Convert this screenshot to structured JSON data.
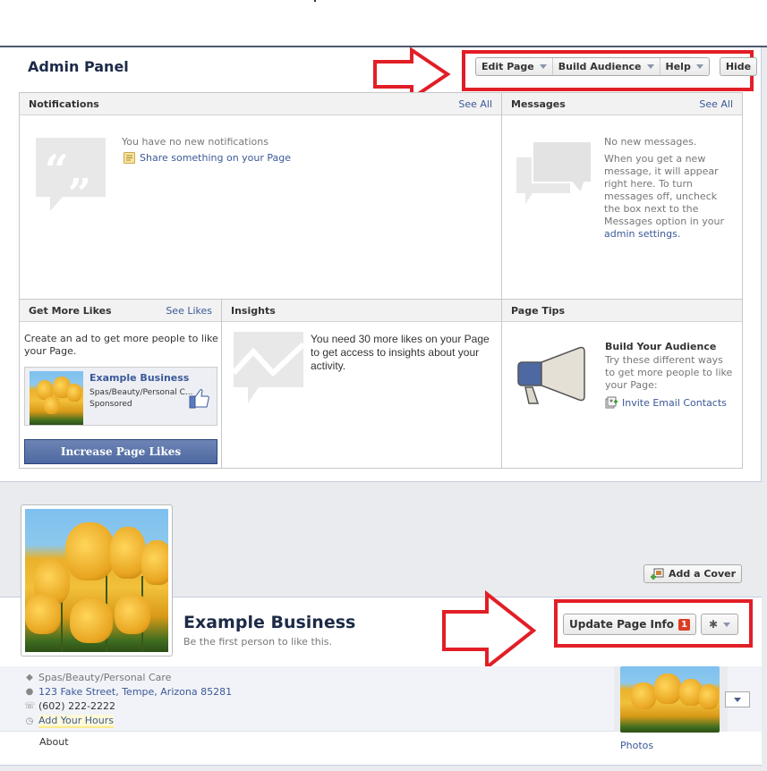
{
  "admin_panel": {
    "title": "Admin Panel",
    "toolbar": {
      "edit_page": "Edit Page",
      "build_audience": "Build Audience",
      "help": "Help",
      "hide": "Hide"
    },
    "notifications": {
      "title": "Notifications",
      "see_all": "See All",
      "empty_text": "You have no new notifications",
      "share_link": "Share something on your Page"
    },
    "messages": {
      "title": "Messages",
      "see_all": "See All",
      "empty_text": "No new messages.",
      "body": "When you get a new message, it will appear right here. To turn messages off, uncheck the box next to the Messages option in your",
      "settings_link": "admin settings."
    },
    "get_more_likes": {
      "title": "Get More Likes",
      "see_likes": "See Likes",
      "description": "Create an ad to get more people to like your Page.",
      "ad": {
        "name": "Example Business",
        "category": "Spas/Beauty/Personal C...",
        "label": "Sponsored"
      },
      "cta": "Increase Page Likes"
    },
    "insights": {
      "title": "Insights",
      "body": "You need 30 more likes on your Page to get access to insights about your activity."
    },
    "page_tips": {
      "title": "Page Tips",
      "tip_title": "Build Your Audience",
      "tip_body": "Try these different ways to get more people to like your Page:",
      "invite_link": "Invite Email Contacts"
    }
  },
  "page": {
    "add_cover": "Add a Cover",
    "name": "Example Business",
    "likes_text": "Be the first person to like this.",
    "update_info": "Update Page Info",
    "update_badge": "1",
    "info": {
      "category": "Spas/Beauty/Personal Care",
      "address": "123 Fake Street, Tempe, Arizona 85281",
      "phone": "(602) 222-2222",
      "hours_link": "Add Your Hours"
    },
    "about": "About",
    "photos": "Photos"
  },
  "colors": {
    "brand": "#3b5998",
    "annotation_red": "#e21e26",
    "badge": "#dd3c25"
  }
}
